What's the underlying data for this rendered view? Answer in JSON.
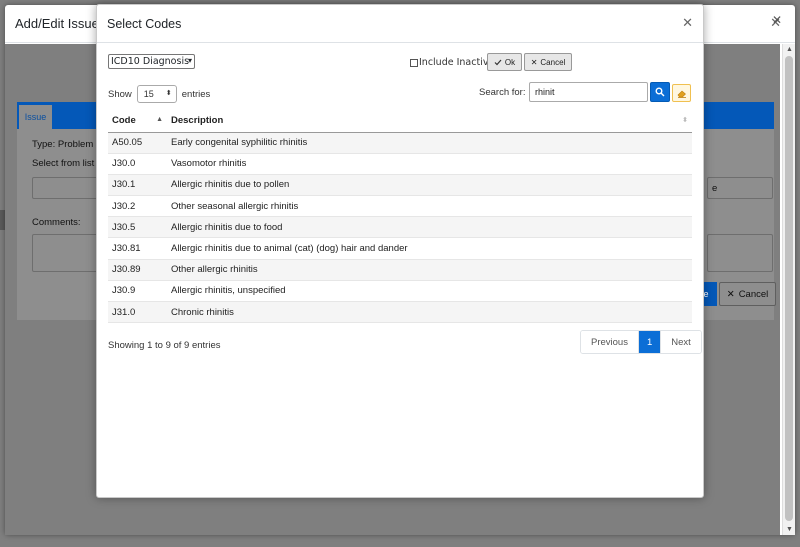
{
  "outer_modal": {
    "title": "Add/Edit Issue",
    "close_icon": "close-icon",
    "tab_label": "Issue",
    "type_label": "Type: Problem",
    "select_from_list_label": "Select from list",
    "comments_label": "Comments:",
    "save_partial": "e",
    "right_field_partial": "e",
    "cancel_label": "Cancel"
  },
  "codes_modal": {
    "title": "Select Codes",
    "close_icon": "close-icon",
    "code_type_selected": "ICD10 Diagnosis",
    "include_inactive_label": "Include Inactive",
    "ok_label": "Ok",
    "cancel_label": "Cancel",
    "show_label": "Show",
    "length_value": "15",
    "entries_label": "entries",
    "search_label": "Search for:",
    "search_value": "rhinit",
    "search_icon": "search-icon",
    "clear_icon": "eraser-icon",
    "columns": [
      "Code",
      "Description"
    ],
    "rows": [
      {
        "code": "A50.05",
        "description": "Early congenital syphilitic rhinitis"
      },
      {
        "code": "J30.0",
        "description": "Vasomotor rhinitis"
      },
      {
        "code": "J30.1",
        "description": "Allergic rhinitis due to pollen"
      },
      {
        "code": "J30.2",
        "description": "Other seasonal allergic rhinitis"
      },
      {
        "code": "J30.5",
        "description": "Allergic rhinitis due to food"
      },
      {
        "code": "J30.81",
        "description": "Allergic rhinitis due to animal (cat) (dog) hair and dander"
      },
      {
        "code": "J30.89",
        "description": "Other allergic rhinitis"
      },
      {
        "code": "J30.9",
        "description": "Allergic rhinitis, unspecified"
      },
      {
        "code": "J31.0",
        "description": "Chronic rhinitis"
      }
    ],
    "info_text": "Showing 1 to 9 of 9 entries",
    "pagination": {
      "previous": "Previous",
      "current": "1",
      "next": "Next"
    }
  },
  "colors": {
    "primary": "#0b6ed6",
    "tab_bar": "#0458b8",
    "warning_border": "#f0c050"
  }
}
